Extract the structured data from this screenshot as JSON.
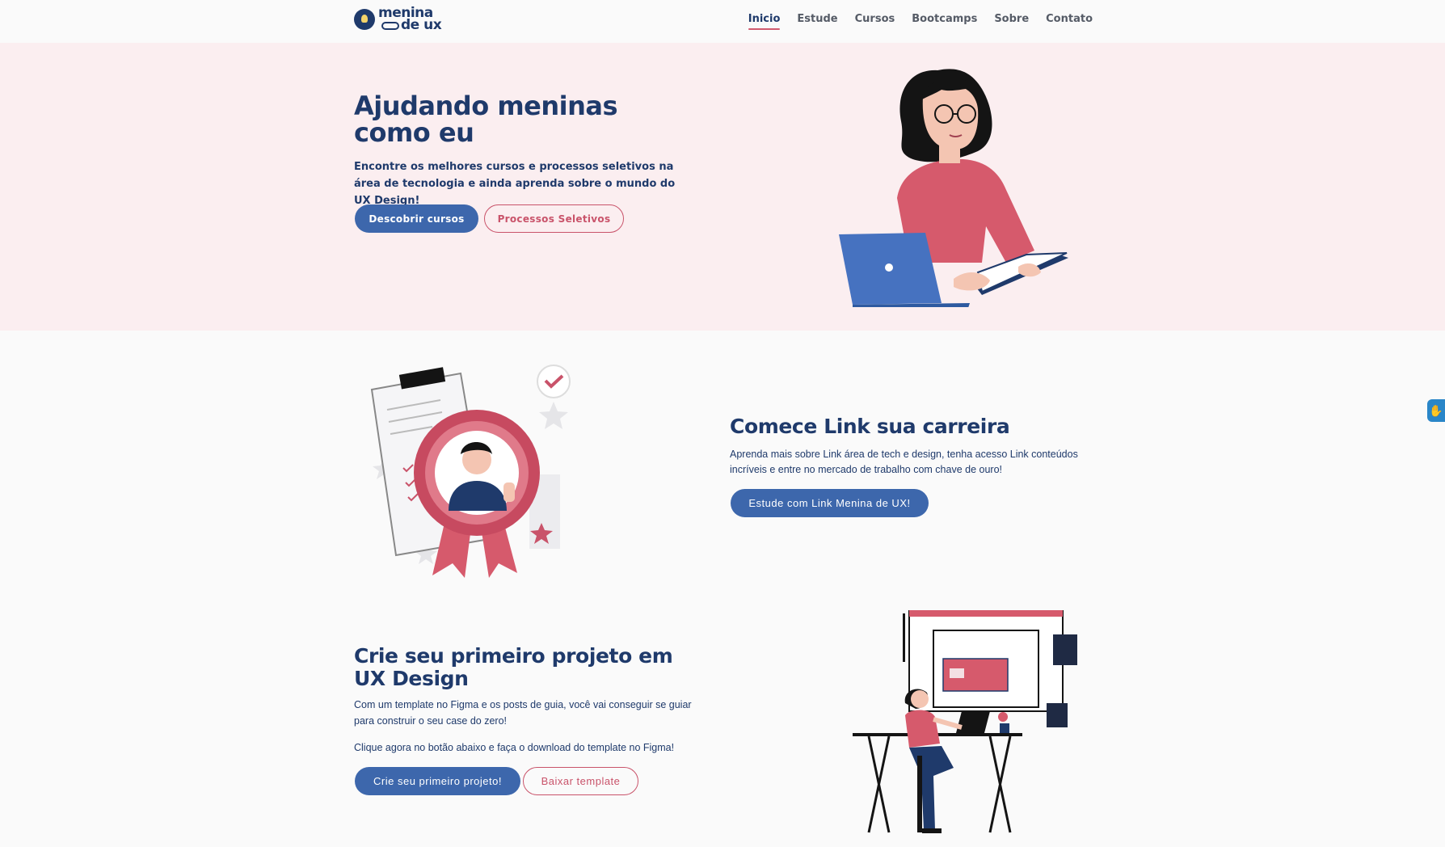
{
  "logo": {
    "line1": "menina",
    "line2": "de ux"
  },
  "nav": [
    "Inicio",
    "Estude",
    "Cursos",
    "Bootcamps",
    "Sobre",
    "Contato"
  ],
  "hero": {
    "title": "Ajudando meninas como eu",
    "description": "Encontre os melhores cursos e processos seletivos na área de tecnologia e ainda aprenda sobre o mundo do UX Design!",
    "primary_button": "Descobrir cursos",
    "secondary_button": "Processos Seletivos"
  },
  "career": {
    "title": "Comece Link sua carreira",
    "description": "Aprenda mais sobre Link área de tech e design, tenha acesso Link conteúdos incríveis e entre no mercado de trabalho com chave de ouro!",
    "button": "Estude com Link Menina de UX!"
  },
  "project": {
    "title": "Crie seu primeiro projeto em UX Design",
    "description": "Com um template no Figma e os posts de guia, você vai conseguir se guiar para construir o seu case do zero!",
    "cta_text": "Clique agora no botão abaixo e faça o download do template no Figma!",
    "primary_button": "Crie seu primeiro projeto!",
    "secondary_button": "Baixar template"
  },
  "colors": {
    "navy": "#1f3a6b",
    "blue_button": "#3d67ac",
    "pink_accent": "#c9536a",
    "hero_bg": "#fbeef0",
    "page_bg": "#fafafa"
  },
  "icons": [
    "lightbulb-logo-icon",
    "accessibility-hand-icon"
  ]
}
